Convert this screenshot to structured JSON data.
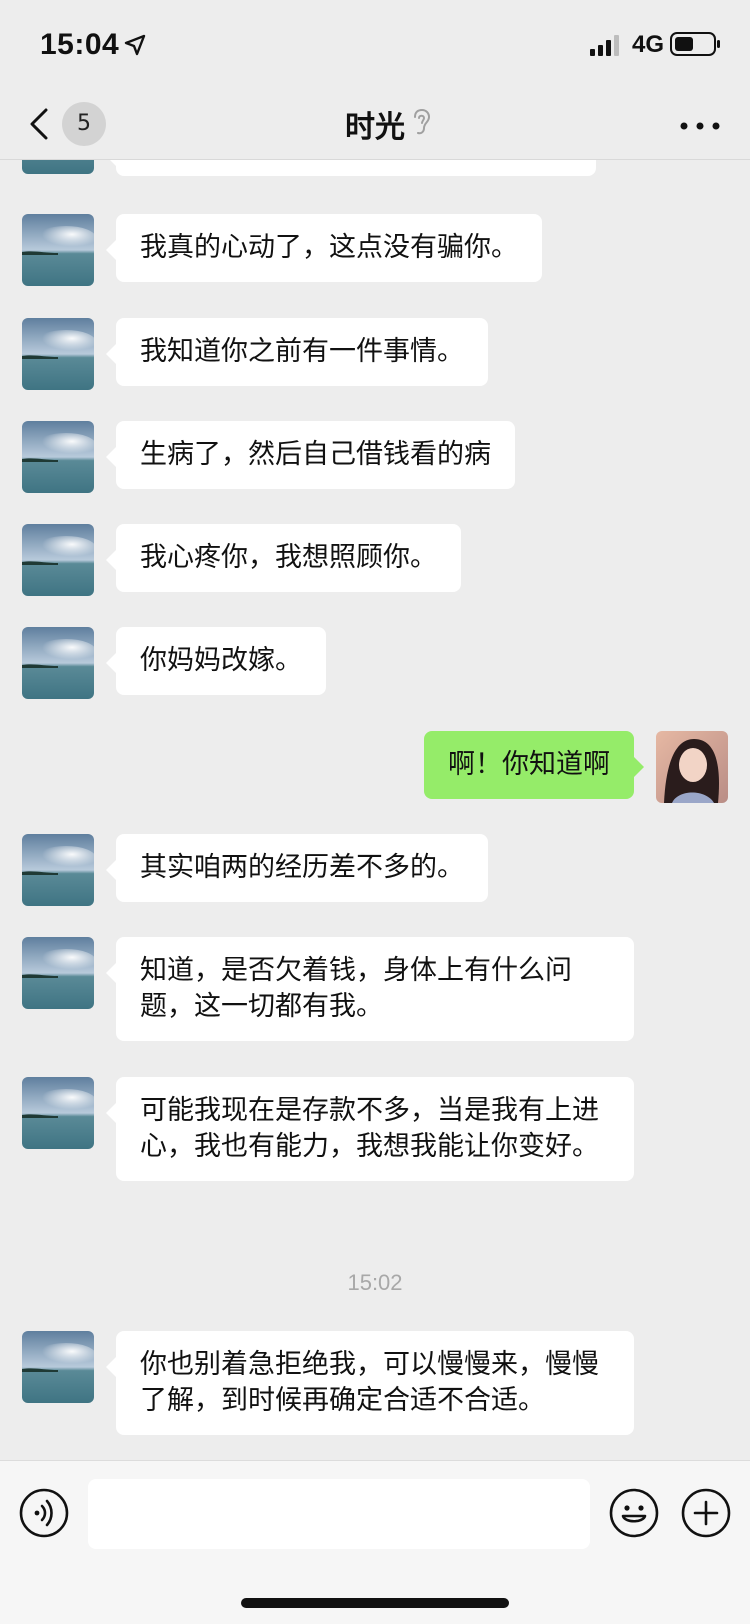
{
  "status_bar": {
    "time": "15:04",
    "network": "4G"
  },
  "nav": {
    "unread_count": "5",
    "title": "时光"
  },
  "messages": [
    {
      "side": "left",
      "text": ""
    },
    {
      "side": "left",
      "text": "我真的心动了，这点没有骗你。"
    },
    {
      "side": "left",
      "text": "我知道你之前有一件事情。"
    },
    {
      "side": "left",
      "text": "生病了，然后自己借钱看的病"
    },
    {
      "side": "left",
      "text": "我心疼你，我想照顾你。"
    },
    {
      "side": "left",
      "text": "你妈妈改嫁。"
    },
    {
      "side": "right",
      "text": "啊！你知道啊"
    },
    {
      "side": "left",
      "text": "其实咱两的经历差不多的。"
    },
    {
      "side": "left",
      "text": "知道，是否欠着钱，身体上有什么问题，这一切都有我。"
    },
    {
      "side": "left",
      "text": "可能我现在是存款不多，当是我有上进心，我也有能力，我想我能让你变好。"
    },
    {
      "side": "left",
      "text": "你也别着急拒绝我，可以慢慢来，慢慢了解，到时候再确定合适不合适。"
    }
  ],
  "timestamp": "15:02",
  "input": {
    "value": "",
    "placeholder": ""
  },
  "colors": {
    "background": "#ededed",
    "bubble_left": "#ffffff",
    "bubble_right": "#95ec69"
  }
}
